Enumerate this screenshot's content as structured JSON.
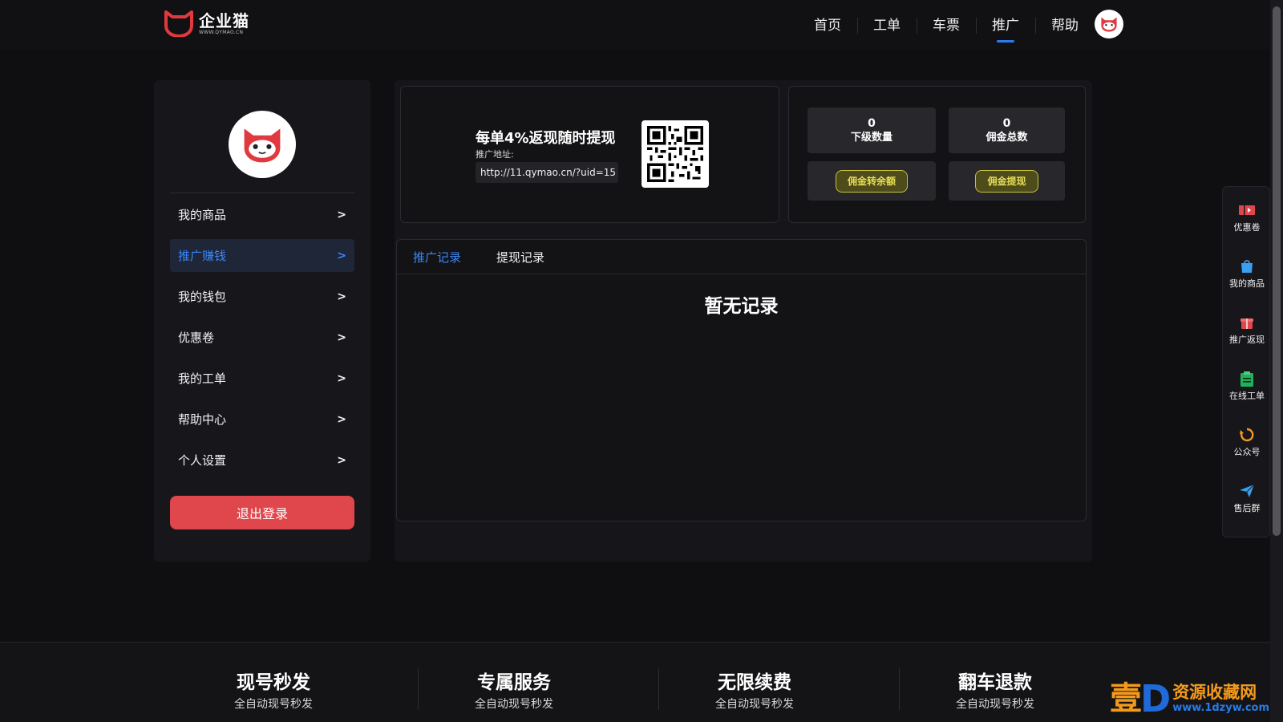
{
  "header": {
    "logo_name": "企业猫",
    "logo_url": "WWW.QYMAO.CN",
    "nav": [
      {
        "label": "首页"
      },
      {
        "label": "工单"
      },
      {
        "label": "车票"
      },
      {
        "label": "推广",
        "active": true
      },
      {
        "label": "帮助"
      }
    ]
  },
  "sidebar": {
    "items": [
      {
        "label": "我的商品",
        "arrow": ">"
      },
      {
        "label": "推广赚钱",
        "arrow": ">",
        "active": true
      },
      {
        "label": "我的钱包",
        "arrow": ">"
      },
      {
        "label": "优惠卷",
        "arrow": ">"
      },
      {
        "label": "我的工单",
        "arrow": ">"
      },
      {
        "label": "帮助中心",
        "arrow": ">"
      },
      {
        "label": "个人设置",
        "arrow": ">"
      }
    ],
    "logout_label": "退出登录"
  },
  "promo": {
    "title": "每单4%返现随时提现",
    "address_label": "推广地址:",
    "address_value": "http://11.qymao.cn/?uid=15"
  },
  "stats": {
    "sub_count_value": "0",
    "sub_count_label": "下级数量",
    "commission_total_value": "0",
    "commission_total_label": "佣金总数",
    "to_balance_label": "佣金转余额",
    "withdraw_label": "佣金提现"
  },
  "records": {
    "tabs": [
      {
        "label": "推广记录",
        "active": true
      },
      {
        "label": "提现记录"
      }
    ],
    "empty_text": "暂无记录"
  },
  "floatbar": {
    "items": [
      {
        "label": "优惠卷",
        "icon": "coupon-icon"
      },
      {
        "label": "我的商品",
        "icon": "bag-icon"
      },
      {
        "label": "推广返现",
        "icon": "gift-icon"
      },
      {
        "label": "在线工单",
        "icon": "clipboard-icon"
      },
      {
        "label": "公众号",
        "icon": "refresh-icon"
      },
      {
        "label": "售后群",
        "icon": "send-icon"
      }
    ]
  },
  "footer": {
    "features": [
      {
        "title": "现号秒发",
        "sub": "全自动现号秒发"
      },
      {
        "title": "专属服务",
        "sub": "全自动现号秒发"
      },
      {
        "title": "无限续费",
        "sub": "全自动现号秒发"
      },
      {
        "title": "翻车退款",
        "sub": "全自动现号秒发"
      }
    ]
  },
  "watermark": {
    "char": "壹",
    "letter": "D",
    "name": "资源收藏网",
    "url": "www.1dzyw.com"
  },
  "colors": {
    "accent": "#3b86f7",
    "logout": "#e0474c",
    "pill_text": "#e8de55",
    "brand_red": "#e0393e"
  }
}
